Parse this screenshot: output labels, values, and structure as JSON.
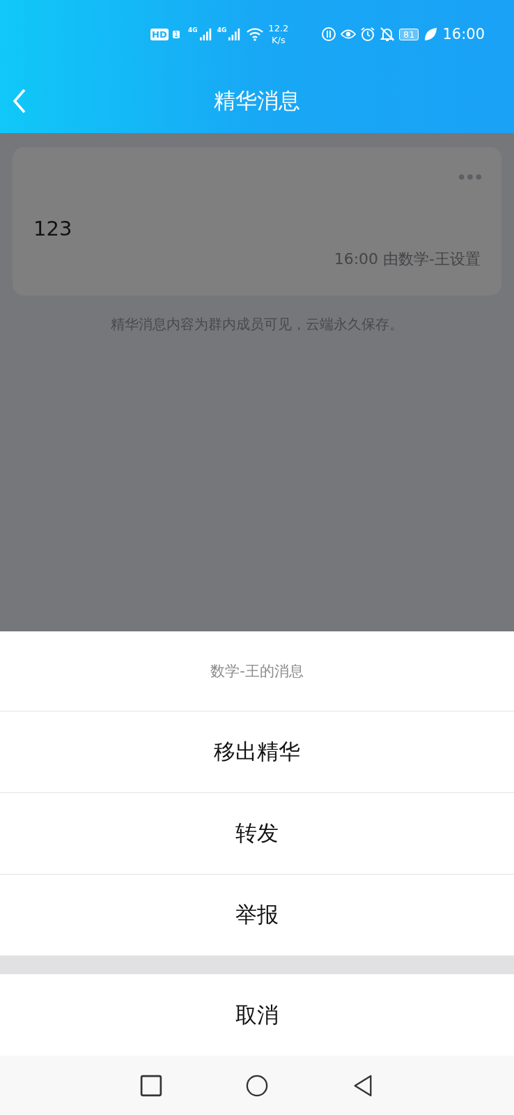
{
  "status_bar": {
    "hd": "HD",
    "sim": "1",
    "signals": [
      {
        "label": "4G"
      },
      {
        "label": "4G"
      }
    ],
    "speed": "12.2",
    "speed_unit": "K/s",
    "battery": "81",
    "time": "16:00"
  },
  "header": {
    "title": "精华消息"
  },
  "message_card": {
    "text": "123",
    "footer": "16:00 由数学-王设置"
  },
  "note": "精华消息内容为群内成员可见，云端永久保存。",
  "action_sheet": {
    "title": "数学-王的消息",
    "actions": [
      "移出精华",
      "转发",
      "举报"
    ],
    "cancel": "取消"
  }
}
